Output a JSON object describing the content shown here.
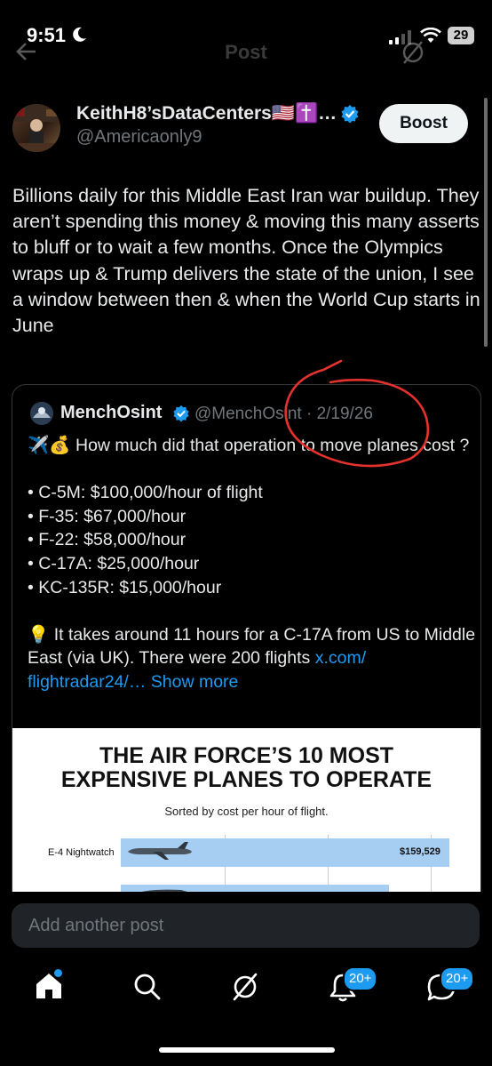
{
  "status_bar": {
    "time": "9:51",
    "battery": "29"
  },
  "header": {
    "title": "Post"
  },
  "post": {
    "author_name": "KeithH8’sDataCenters🇺🇸✝️…",
    "author_handle": "@Americaonly9",
    "boost_label": "Boost",
    "text": "Billions daily for this Middle East Iran war buildup. They aren’t spending this money & moving this many asserts to bluff or to wait a few months. Once the Olympics wraps up & Trump delivers the state of the union, I see a window between then & when the World Cup starts in June"
  },
  "quote": {
    "name": "MenchOsint",
    "handle": "@MenchOsint",
    "separator": "·",
    "date": "2/19/26",
    "intro_emoji": "✈️💰",
    "intro": "How much did that operation to move planes cost ?",
    "bullets": [
      "• C-5M: $100,000/hour of flight",
      "• F-35: $67,000/hour",
      "• F-22: $58,000/hour",
      "• C-17A: $25,000/hour",
      "• KC-135R: $15,000/hour"
    ],
    "tip_emoji": "💡",
    "tip": "It takes around 11 hours for a C-17A from US to Middle East (via UK). There were 200 flights",
    "link_1": "x.com/",
    "link_2": "flightradar24/…",
    "show_more": "Show more"
  },
  "infographic": {
    "title_line1": "THE AIR FORCE’S 10 MOST",
    "title_line2": "EXPENSIVE PLANES TO OPERATE",
    "subtitle": "Sorted by cost per hour of flight.",
    "bar1_label": "E-4 Nightwatch",
    "bar1_value": "$159,529"
  },
  "reply": {
    "placeholder": "Add another post"
  },
  "nav": {
    "notif_badge": "20+",
    "msg_badge": "20+"
  },
  "colors": {
    "accent": "#1d9bf0",
    "annotation": "#e5322d",
    "bar": "#a6cdf2"
  }
}
